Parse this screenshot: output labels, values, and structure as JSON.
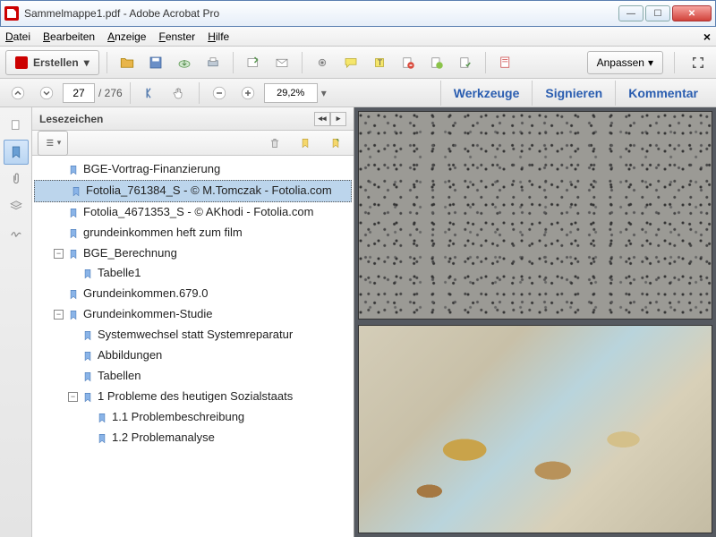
{
  "window": {
    "title": "Sammelmappe1.pdf - Adobe Acrobat Pro"
  },
  "menu": {
    "file": "Datei",
    "edit": "Bearbeiten",
    "view": "Anzeige",
    "window": "Fenster",
    "help": "Hilfe"
  },
  "toolbar": {
    "create": "Erstellen",
    "customize": "Anpassen",
    "page_current": "27",
    "page_total": "276",
    "zoom": "29,2%"
  },
  "tabs": {
    "tools": "Werkzeuge",
    "sign": "Signieren",
    "comment": "Kommentar"
  },
  "bookmarks": {
    "title": "Lesezeichen",
    "items": [
      {
        "label": "BGE-Vortrag-Finanzierung",
        "level": 1
      },
      {
        "label": "Fotolia_761384_S - © M.Tomczak - Fotolia.com",
        "level": 1,
        "selected": true
      },
      {
        "label": "Fotolia_4671353_S - © AKhodi - Fotolia.com",
        "level": 1
      },
      {
        "label": "grundeinkommen heft zum film",
        "level": 1
      },
      {
        "label": "BGE_Berechnung",
        "level": 1,
        "expanded": true
      },
      {
        "label": "Tabelle1",
        "level": 2
      },
      {
        "label": "Grundeinkommen.679.0",
        "level": 1
      },
      {
        "label": "Grundeinkommen-Studie",
        "level": 1,
        "expanded": true
      },
      {
        "label": "Systemwechsel statt Systemreparatur",
        "level": 2
      },
      {
        "label": "Abbildungen",
        "level": 2
      },
      {
        "label": "Tabellen",
        "level": 2
      },
      {
        "label": "1  Probleme des heutigen Sozialstaats",
        "level": 2,
        "expanded": true
      },
      {
        "label": "1.1 Problembeschreibung",
        "level": 3
      },
      {
        "label": "1.2 Problemanalyse",
        "level": 3
      }
    ]
  }
}
